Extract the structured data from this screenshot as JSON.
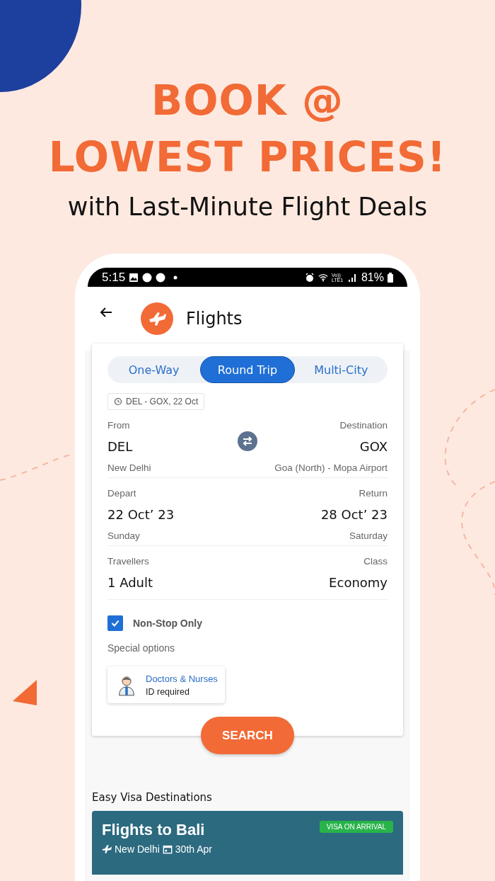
{
  "promo": {
    "headline": [
      "BOOK @",
      "LOWEST PRICES!"
    ],
    "subtitle": "with Last-Minute Flight Deals"
  },
  "status_bar": {
    "time": "5:15",
    "network": "Vo)) LTE1",
    "battery": "81%"
  },
  "header": {
    "title": "Flights"
  },
  "trip_tabs": [
    {
      "label": "One-Way",
      "selected": false
    },
    {
      "label": "Round Trip",
      "selected": true
    },
    {
      "label": "Multi-City",
      "selected": false
    }
  ],
  "recent_search": "DEL - GOX, 22 Oct",
  "field_rows": [
    {
      "left": {
        "label": "From",
        "value": "DEL",
        "sub": "New Delhi"
      },
      "right": {
        "label": "Destination",
        "value": "GOX",
        "sub": "Goa (North) - Mopa Airport"
      },
      "swap": true
    },
    {
      "left": {
        "label": "Depart",
        "value": "22 Oct’ 23",
        "sub": "Sunday"
      },
      "right": {
        "label": "Return",
        "value": "28 Oct’ 23",
        "sub": "Saturday"
      },
      "swap": false
    },
    {
      "left": {
        "label": "Travellers",
        "value": "1 Adult"
      },
      "right": {
        "label": "Class",
        "value": "Economy"
      },
      "swap": false
    }
  ],
  "non_stop": {
    "label": "Non-Stop Only",
    "checked": true
  },
  "special_options": {
    "label": "Special options",
    "items": [
      {
        "title": "Doctors & Nurses",
        "subtitle": "ID required"
      }
    ]
  },
  "search_button": "SEARCH",
  "easy_visa": {
    "title": "Easy Visa Destinations",
    "cards": [
      {
        "title": "Flights to Bali",
        "badge": "VISA ON ARRIVAL",
        "origin": "New Delhi",
        "date": "30th Apr"
      }
    ]
  }
}
